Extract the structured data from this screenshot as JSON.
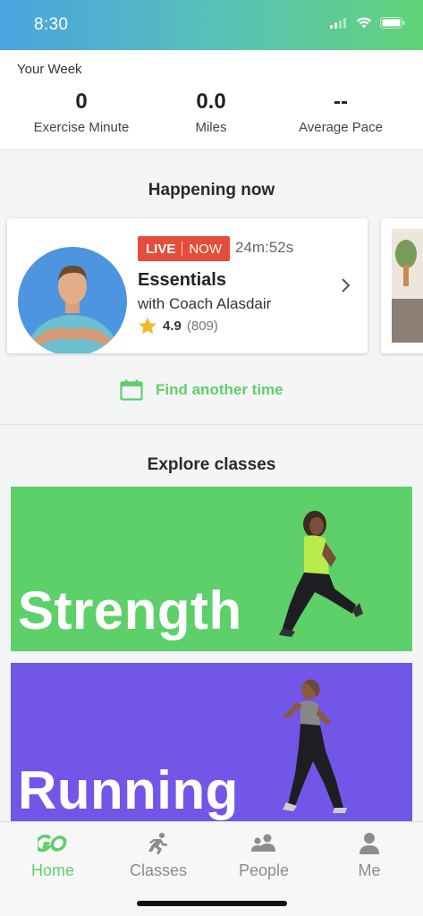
{
  "status_bar": {
    "time": "8:30"
  },
  "week": {
    "title": "Your Week",
    "stats": [
      {
        "value": "0",
        "label": "Exercise Minute"
      },
      {
        "value": "0.0",
        "label": "Miles"
      },
      {
        "value": "--",
        "label": "Average Pace"
      }
    ]
  },
  "happening": {
    "title": "Happening now",
    "card": {
      "live": "LIVE",
      "now": "NOW",
      "timer": "24m:52s",
      "class_name": "Essentials",
      "coach": "with Coach Alasdair",
      "rating": "4.9",
      "rating_count": "(809)"
    },
    "find_time": "Find another time"
  },
  "explore": {
    "title": "Explore classes",
    "tiles": [
      {
        "label": "Strength",
        "color": "#5ed06a"
      },
      {
        "label": "Running",
        "color": "#7256e8"
      }
    ]
  },
  "tabs": [
    {
      "label": "Home",
      "icon": "go-logo-icon"
    },
    {
      "label": "Classes",
      "icon": "runner-icon"
    },
    {
      "label": "People",
      "icon": "people-icon"
    },
    {
      "label": "Me",
      "icon": "person-icon"
    }
  ],
  "colors": {
    "accent": "#5fcf68",
    "live": "#e34d3a",
    "strength": "#5ed06a",
    "running": "#7256e8"
  }
}
